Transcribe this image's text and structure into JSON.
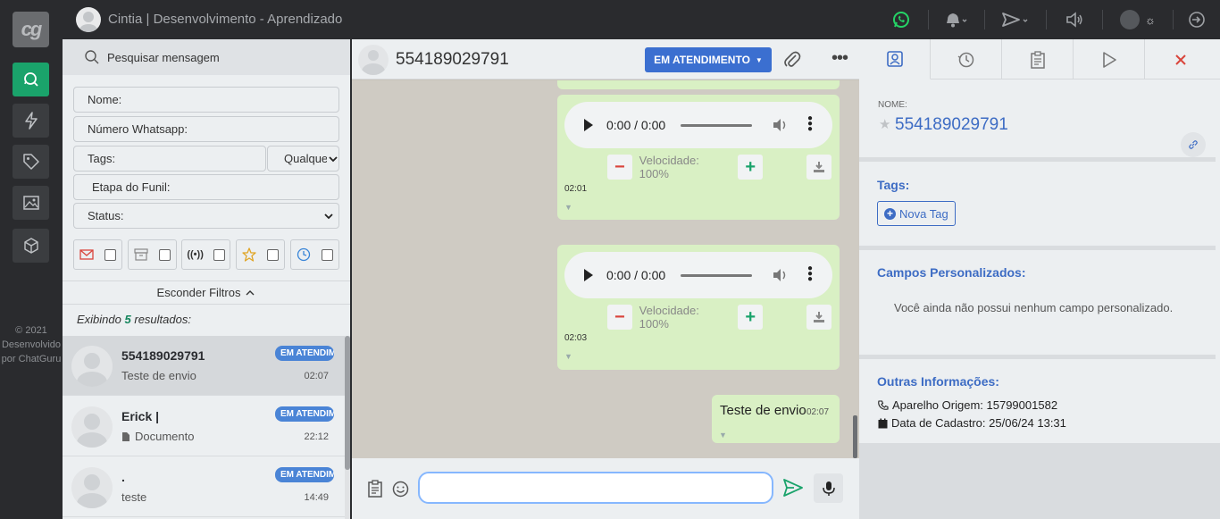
{
  "header": {
    "logo": "cg",
    "user_name": "Cintia | Desenvolvimento - Aprendizado"
  },
  "sidebar": {
    "copyright": [
      "© 2021",
      "Desenvolvido",
      "por ChatGuru"
    ]
  },
  "left_panel": {
    "search_placeholder": "Pesquisar mensagem",
    "filters": {
      "name": "Nome:",
      "whatsapp": "Número Whatsapp:",
      "tags": "Tags:",
      "tags_mode": "Qualquer",
      "funnel": "Etapa do Funil:",
      "status": "Status:"
    },
    "hide_filters": "Esconder Filtros",
    "results_prefix": "Exibindo",
    "results_count": "5",
    "results_suffix": "resultados:",
    "conversations": [
      {
        "name": "554189029791",
        "message": "Teste de envio",
        "badge": "EM ATENDIMENTO",
        "time": "02:07"
      },
      {
        "name": "Erick |",
        "message": "Documento",
        "badge": "EM ATENDIMENTO",
        "time": "22:12"
      },
      {
        "name": ".",
        "message": "teste",
        "badge": "EM ATENDIMENTO",
        "time": "14:49"
      }
    ]
  },
  "chat": {
    "contact": "554189029791",
    "status_button": "EM ATENDIMENTO",
    "audio1": {
      "time": "0:00 / 0:00",
      "speed": "Velocidade: 100%",
      "sent": "02:01"
    },
    "audio2": {
      "time": "0:00 / 0:00",
      "speed": "Velocidade: 100%",
      "sent": "02:03"
    },
    "text_message": {
      "text": "Teste de envio",
      "time": "02:07"
    },
    "input_value": ""
  },
  "right_panel": {
    "name_label": "NOME:",
    "name_value": "554189029791",
    "tags_title": "Tags:",
    "new_tag": "Nova Tag",
    "custom_title": "Campos Personalizados:",
    "custom_empty": "Você ainda não possui nenhum campo personalizado.",
    "other_title": "Outras Informações:",
    "device_label": "Aparelho Origem:",
    "device_value": "15799001582",
    "date_label": "Data de Cadastro:",
    "date_value": "25/06/24 13:31"
  }
}
